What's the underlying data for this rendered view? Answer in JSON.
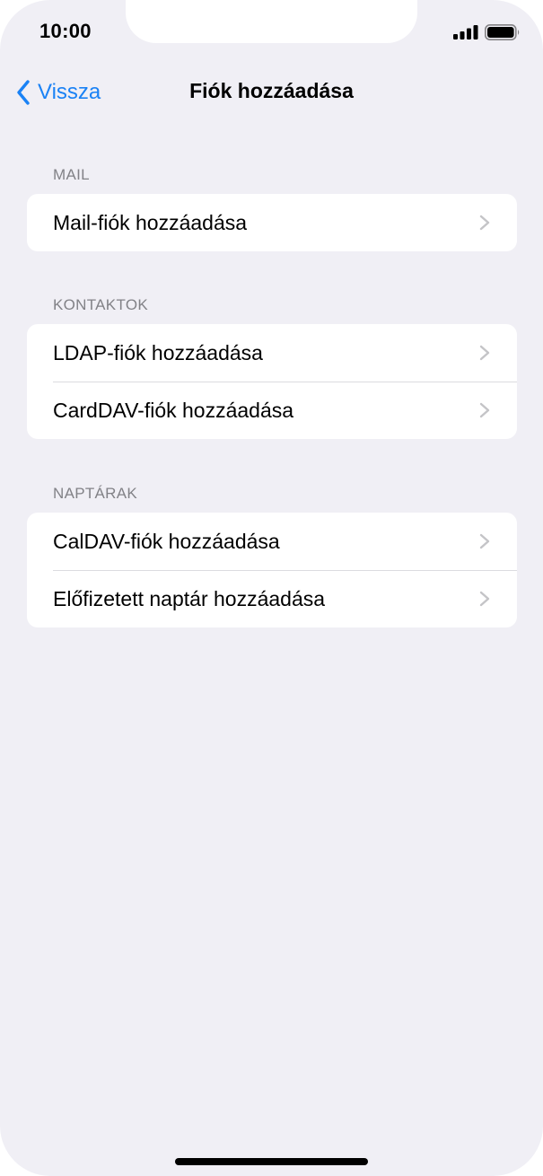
{
  "status_bar": {
    "time": "10:00"
  },
  "nav": {
    "back_label": "Vissza",
    "title": "Fiók hozzáadása"
  },
  "sections": [
    {
      "header": "MAIL",
      "items": [
        {
          "label": "Mail-fiók hozzáadása"
        }
      ]
    },
    {
      "header": "KONTAKTOK",
      "items": [
        {
          "label": "LDAP-fiók hozzáadása"
        },
        {
          "label": "CardDAV-fiók hozzáadása"
        }
      ]
    },
    {
      "header": "NAPTÁRAK",
      "items": [
        {
          "label": "CalDAV-fiók hozzáadása"
        },
        {
          "label": "Előfizetett naptár hozzáadása"
        }
      ]
    }
  ],
  "colors": {
    "accent": "#1a82f5",
    "background": "#f0eff5",
    "cell_background": "#ffffff",
    "section_header": "#828287",
    "separator": "#dcdce0",
    "chevron": "#c4c4c7"
  },
  "icons": {
    "back": "chevron-left-icon",
    "disclosure": "chevron-right-icon",
    "signal": "cellular-signal-icon",
    "battery": "battery-icon"
  }
}
